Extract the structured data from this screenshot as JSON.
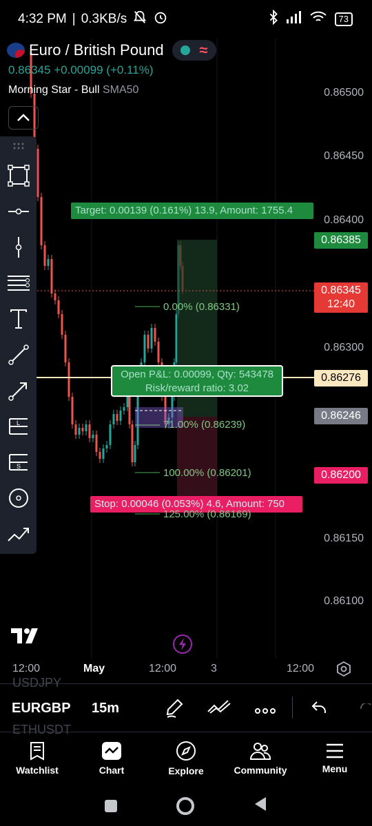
{
  "status": {
    "time": "4:32 PM",
    "speed": "0.3KB/s",
    "battery": "73"
  },
  "header": {
    "symbol": "Euro / British Pound",
    "price": "0.86345",
    "change": "+0.00099 (+0.11%)",
    "indicator_name": "Morning Star - Bull",
    "indicator_extra": "SMA50"
  },
  "axis": {
    "prices": [
      "0.86500",
      "0.86450",
      "0.86400",
      "0.86300",
      "0.86150",
      "0.86100"
    ],
    "times": [
      "12:00",
      "May",
      "12:00",
      "3",
      "12:00"
    ]
  },
  "tags": {
    "target_price": "0.86385",
    "current_price": "0.86345",
    "countdown": "12:40",
    "entry_price": "0.86276",
    "mid_price": "0.86246",
    "stop_price": "0.86200"
  },
  "position": {
    "target_label": "Target: 0.00139 (0.161%) 13.9, Amount: 1755.4",
    "open_pl": "Open P&L: 0.00099, Qty: 543478",
    "risk_reward": "Risk/reward ratio: 3.02",
    "stop_label": "Stop: 0.00046 (0.053%) 4.6, Amount: 750"
  },
  "fib": {
    "level_0": "0.00% (0.86331)",
    "level_71": "71.00% (0.86239)",
    "level_100": "100.00% (0.86201)",
    "level_125": "125.00% (0.86169)"
  },
  "bottom": {
    "symbol": "EURGBP",
    "interval": "15m",
    "ghost_above": "USDJPY",
    "ghost_below": "ETHUSDT"
  },
  "nav": {
    "watchlist": "Watchlist",
    "chart": "Chart",
    "explore": "Explore",
    "community": "Community",
    "menu": "Menu"
  },
  "colors": {
    "bull": "#26a69a",
    "bear": "#ef5350",
    "target_green": "#1e8a3e",
    "stop_pink": "#e91e63",
    "entry_line": "#fbe7c0"
  }
}
